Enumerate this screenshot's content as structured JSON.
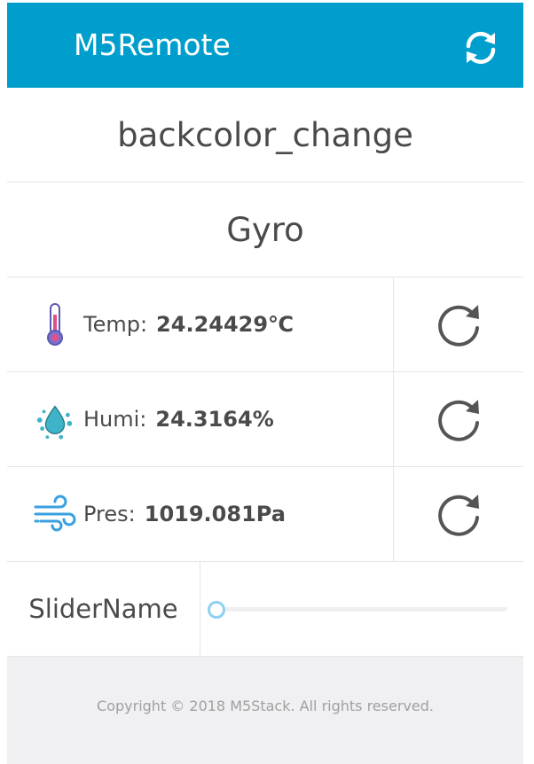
{
  "header": {
    "title": "M5Remote"
  },
  "buttons": [
    {
      "label": "backcolor_change"
    },
    {
      "label": "Gyro"
    }
  ],
  "sensors": [
    {
      "label": "Temp:",
      "value": "24.24429℃",
      "icon": "thermometer-icon"
    },
    {
      "label": "Humi:",
      "value": "24.3164%",
      "icon": "humidity-drops-icon"
    },
    {
      "label": "Pres:",
      "value": "1019.081Pa",
      "icon": "wind-icon"
    }
  ],
  "slider": {
    "label": "SliderName",
    "value_fraction": 0.0
  },
  "footer": {
    "copyright": "Copyright © 2018 M5Stack. All rights reserved."
  },
  "colors": {
    "header": "#009ecc",
    "slider_thumb": "#8fd0f0"
  }
}
